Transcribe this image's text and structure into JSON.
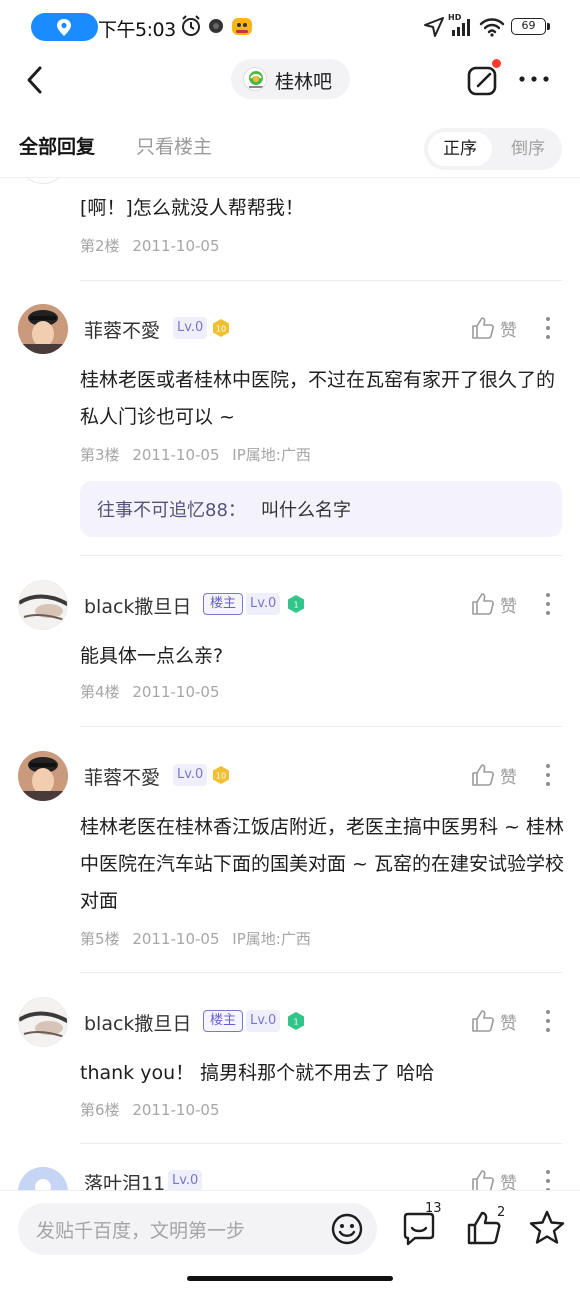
{
  "status_bar": {
    "time": "下午5:03",
    "battery": "69",
    "network": "HD"
  },
  "nav": {
    "forum_name": "桂林吧"
  },
  "tabs": {
    "all_replies": "全部回复",
    "op_only": "只看楼主",
    "order_asc": "正序",
    "order_desc": "倒序"
  },
  "floors": [
    {
      "content": "[啊！]怎么就没人帮帮我！",
      "floor_no": "第2楼",
      "date": "2011-10-05"
    },
    {
      "username": "菲蓉不愛",
      "level": "Lv.0",
      "level_badge": "10",
      "like_label": "赞",
      "content": "桂林老医或者桂林中医院，不过在瓦窑有家开了很久了的私人门诊也可以 ~",
      "floor_no": "第3楼",
      "date": "2011-10-05",
      "ip": "IP属地:广西",
      "sub_reply": {
        "user": "往事不可追忆88：",
        "text": "叫什么名字"
      }
    },
    {
      "username": "black撒旦日",
      "op_badge": "楼主",
      "level": "Lv.0",
      "level_badge": "1",
      "like_label": "赞",
      "content": "能具体一点么亲?",
      "floor_no": "第4楼",
      "date": "2011-10-05"
    },
    {
      "username": "菲蓉不愛",
      "level": "Lv.0",
      "level_badge": "10",
      "like_label": "赞",
      "content": "桂林老医在桂林香江饭店附近，老医主搞中医男科 ~ 桂林中医院在汽车站下面的国美对面 ~ 瓦窑的在建安试验学校对面",
      "floor_no": "第5楼",
      "date": "2011-10-05",
      "ip": "IP属地:广西"
    },
    {
      "username": "black撒旦日",
      "op_badge": "楼主",
      "level": "Lv.0",
      "level_badge": "1",
      "like_label": "赞",
      "content": "thank you！ 搞男科那个就不用去了 哈哈",
      "floor_no": "第6楼",
      "date": "2011-10-05"
    },
    {
      "username": "落叶泪11",
      "level": "Lv.0",
      "like_label": "赞"
    }
  ],
  "bottom_bar": {
    "placeholder": "发贴千百度，文明第一步",
    "comment_count": "13",
    "like_count": "2"
  },
  "colors": {
    "accent": "#1a8cff",
    "op_badge": "#6761cf",
    "level_badge_bg": "#efeefb",
    "notification_dot": "#ff3b30",
    "gold_badge": "#f0c030",
    "green_badge": "#33c48a"
  }
}
